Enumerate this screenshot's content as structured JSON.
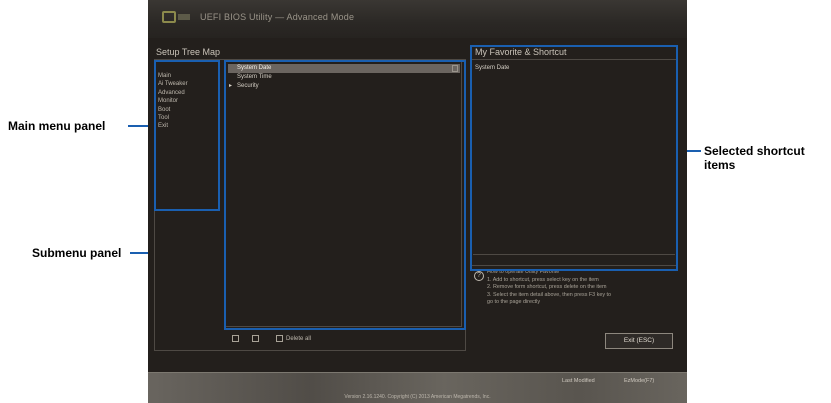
{
  "header": {
    "title": "UEFI BIOS Utility — Advanced Mode"
  },
  "setup_tree": {
    "title": "Setup Tree Map",
    "menu_items": [
      "Main",
      "Ai Tweaker",
      "Advanced",
      "Monitor",
      "Boot",
      "Tool",
      "Exit"
    ],
    "submenu_items": [
      {
        "label": "System Date",
        "selected": true
      },
      {
        "label": "System Time",
        "selected": false
      },
      {
        "label": "Security",
        "selected": false
      }
    ]
  },
  "favorites": {
    "title": "My Favorite & Shortcut",
    "items": [
      "System Date"
    ]
  },
  "help": {
    "lines": [
      "How to operate Utility Favorite",
      "1. Add to shortcut, press select key on the item",
      "2. Remove form shortcut, press delete on the item",
      "3. Select the item detail above, then press F3 key to",
      "go to the page directly"
    ]
  },
  "toolbar": {
    "delete_all_label": "Delete all"
  },
  "buttons": {
    "exit_label": "Exit (ESC)"
  },
  "footer": {
    "version": "Version 2.16.1240. Copyright (C) 2013 American Megatrends, Inc.",
    "last_modified": "Last Modified",
    "ezmode": "EzMode(F7)"
  },
  "callouts": {
    "main_menu": "Main menu panel",
    "submenu": "Submenu panel",
    "selected_shortcut_line1": "Selected shortcut",
    "selected_shortcut_line2": "items"
  },
  "colors": {
    "callout_line": "#1a5fb0",
    "bios_background": "#231f1c"
  }
}
